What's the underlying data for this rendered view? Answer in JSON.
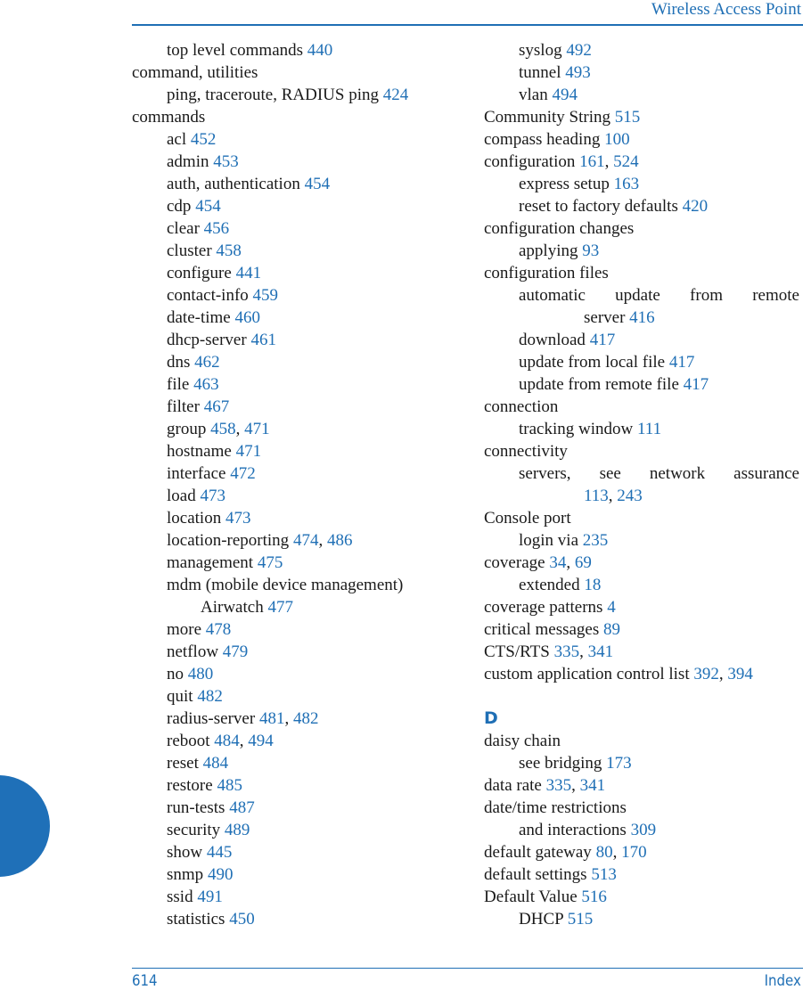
{
  "header": {
    "title": "Wireless Access Point"
  },
  "footer": {
    "page_number": "614",
    "section": "Index"
  },
  "colors": {
    "accent": "#1f6fb5",
    "text": "#1a1a1a",
    "tab": "#1f70b8"
  },
  "left_column": [
    {
      "level": 1,
      "term": "top level commands",
      "pages": [
        "440"
      ]
    },
    {
      "level": 0,
      "term": "command, utilities",
      "pages": []
    },
    {
      "level": 1,
      "term": "ping, traceroute, RADIUS ping",
      "pages": [
        "424"
      ]
    },
    {
      "level": 0,
      "term": "commands",
      "pages": []
    },
    {
      "level": 1,
      "term": "acl",
      "pages": [
        "452"
      ]
    },
    {
      "level": 1,
      "term": "admin",
      "pages": [
        "453"
      ]
    },
    {
      "level": 1,
      "term": "auth, authentication",
      "pages": [
        "454"
      ]
    },
    {
      "level": 1,
      "term": "cdp",
      "pages": [
        "454"
      ]
    },
    {
      "level": 1,
      "term": "clear",
      "pages": [
        "456"
      ]
    },
    {
      "level": 1,
      "term": "cluster",
      "pages": [
        "458"
      ]
    },
    {
      "level": 1,
      "term": "configure",
      "pages": [
        "441"
      ]
    },
    {
      "level": 1,
      "term": "contact-info",
      "pages": [
        "459"
      ]
    },
    {
      "level": 1,
      "term": "date-time",
      "pages": [
        "460"
      ]
    },
    {
      "level": 1,
      "term": "dhcp-server",
      "pages": [
        "461"
      ]
    },
    {
      "level": 1,
      "term": "dns",
      "pages": [
        "462"
      ]
    },
    {
      "level": 1,
      "term": "file",
      "pages": [
        "463"
      ]
    },
    {
      "level": 1,
      "term": "filter",
      "pages": [
        "467"
      ]
    },
    {
      "level": 1,
      "term": "group",
      "pages": [
        "458",
        "471"
      ]
    },
    {
      "level": 1,
      "term": "hostname",
      "pages": [
        "471"
      ]
    },
    {
      "level": 1,
      "term": "interface",
      "pages": [
        "472"
      ]
    },
    {
      "level": 1,
      "term": "load",
      "pages": [
        "473"
      ]
    },
    {
      "level": 1,
      "term": "location",
      "pages": [
        "473"
      ]
    },
    {
      "level": 1,
      "term": "location-reporting",
      "pages": [
        "474",
        "486"
      ]
    },
    {
      "level": 1,
      "term": "management",
      "pages": [
        "475"
      ]
    },
    {
      "level": 1,
      "term": "mdm (mobile device management)",
      "pages": []
    },
    {
      "level": 2,
      "term": "Airwatch",
      "pages": [
        "477"
      ]
    },
    {
      "level": 1,
      "term": "more",
      "pages": [
        "478"
      ]
    },
    {
      "level": 1,
      "term": "netflow",
      "pages": [
        "479"
      ]
    },
    {
      "level": 1,
      "term": "no",
      "pages": [
        "480"
      ]
    },
    {
      "level": 1,
      "term": "quit",
      "pages": [
        "482"
      ]
    },
    {
      "level": 1,
      "term": "radius-server",
      "pages": [
        "481",
        "482"
      ]
    },
    {
      "level": 1,
      "term": "reboot",
      "pages": [
        "484",
        "494"
      ]
    },
    {
      "level": 1,
      "term": "reset",
      "pages": [
        "484"
      ]
    },
    {
      "level": 1,
      "term": "restore",
      "pages": [
        "485"
      ]
    },
    {
      "level": 1,
      "term": "run-tests",
      "pages": [
        "487"
      ]
    },
    {
      "level": 1,
      "term": "security",
      "pages": [
        "489"
      ]
    },
    {
      "level": 1,
      "term": "show",
      "pages": [
        "445"
      ]
    },
    {
      "level": 1,
      "term": "snmp",
      "pages": [
        "490"
      ]
    },
    {
      "level": 1,
      "term": "ssid",
      "pages": [
        "491"
      ]
    },
    {
      "level": 1,
      "term": "statistics",
      "pages": [
        "450"
      ]
    }
  ],
  "right_column": [
    {
      "level": 1,
      "term": "syslog",
      "pages": [
        "492"
      ]
    },
    {
      "level": 1,
      "term": "tunnel",
      "pages": [
        "493"
      ]
    },
    {
      "level": 1,
      "term": "vlan",
      "pages": [
        "494"
      ]
    },
    {
      "level": 0,
      "term": "Community String",
      "pages": [
        "515"
      ]
    },
    {
      "level": 0,
      "term": "compass heading",
      "pages": [
        "100"
      ]
    },
    {
      "level": 0,
      "term": "configuration",
      "pages": [
        "161",
        "524"
      ]
    },
    {
      "level": 1,
      "term": "express setup",
      "pages": [
        "163"
      ]
    },
    {
      "level": 1,
      "term": "reset to factory defaults",
      "pages": [
        "420"
      ]
    },
    {
      "level": 0,
      "term": "configuration changes",
      "pages": []
    },
    {
      "level": 1,
      "term": "applying",
      "pages": [
        "93"
      ]
    },
    {
      "level": 0,
      "term": "configuration files",
      "pages": []
    },
    {
      "level": 1,
      "term": "automatic update from remote",
      "wrap": "server",
      "pages": [
        "416"
      ]
    },
    {
      "level": 1,
      "term": "download",
      "pages": [
        "417"
      ]
    },
    {
      "level": 1,
      "term": "update from local file",
      "pages": [
        "417"
      ]
    },
    {
      "level": 1,
      "term": "update from remote file",
      "pages": [
        "417"
      ]
    },
    {
      "level": 0,
      "term": "connection",
      "pages": []
    },
    {
      "level": 1,
      "term": "tracking window",
      "pages": [
        "111"
      ]
    },
    {
      "level": 0,
      "term": "connectivity",
      "pages": []
    },
    {
      "level": 1,
      "term": "servers, see network assurance",
      "wrap": "",
      "pages": [
        "113",
        "243"
      ]
    },
    {
      "level": 0,
      "term": "Console port",
      "pages": []
    },
    {
      "level": 1,
      "term": "login via",
      "pages": [
        "235"
      ]
    },
    {
      "level": 0,
      "term": "coverage",
      "pages": [
        "34",
        "69"
      ]
    },
    {
      "level": 1,
      "term": "extended",
      "pages": [
        "18"
      ]
    },
    {
      "level": 0,
      "term": "coverage patterns",
      "pages": [
        "4"
      ]
    },
    {
      "level": 0,
      "term": "critical messages",
      "pages": [
        "89"
      ]
    },
    {
      "level": 0,
      "term": "CTS/RTS",
      "pages": [
        "335",
        "341"
      ]
    },
    {
      "level": 0,
      "term": "custom application control list",
      "pages": [
        "392",
        "394"
      ]
    },
    {
      "letter": "D"
    },
    {
      "level": 0,
      "term": "daisy chain",
      "pages": []
    },
    {
      "level": 1,
      "term": "see bridging",
      "pages": [
        "173"
      ]
    },
    {
      "level": 0,
      "term": "data rate",
      "pages": [
        "335",
        "341"
      ]
    },
    {
      "level": 0,
      "term": "date/time restrictions",
      "pages": []
    },
    {
      "level": 1,
      "term": "and interactions",
      "pages": [
        "309"
      ]
    },
    {
      "level": 0,
      "term": "default gateway",
      "pages": [
        "80",
        "170"
      ]
    },
    {
      "level": 0,
      "term": "default settings",
      "pages": [
        "513"
      ]
    },
    {
      "level": 0,
      "term": "Default Value",
      "pages": [
        "516"
      ]
    },
    {
      "level": 1,
      "term": "DHCP",
      "pages": [
        "515"
      ]
    }
  ]
}
